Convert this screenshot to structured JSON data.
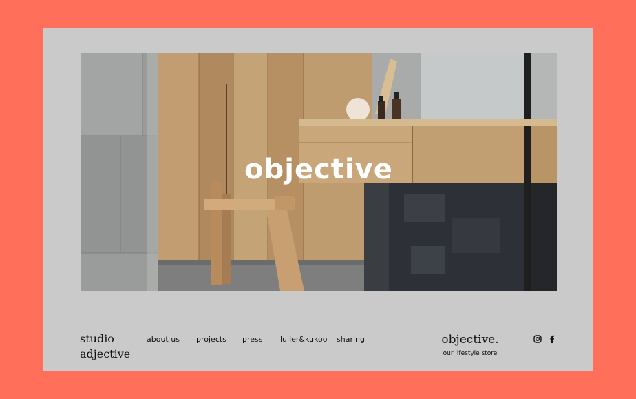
{
  "hero": {
    "logo_text": "objective",
    "logo_color": "#FFFFFF"
  },
  "brand": {
    "line1": "studio",
    "line2": "adjective"
  },
  "nav": {
    "items": [
      {
        "label": "about us"
      },
      {
        "label": "projects"
      },
      {
        "label": "press"
      },
      {
        "label": "luller&kukoo"
      },
      {
        "label": "sharing"
      }
    ]
  },
  "store": {
    "name": "objective.",
    "subtitle": "our lifestyle store"
  },
  "social": {
    "icons": [
      "instagram-icon",
      "facebook-icon"
    ]
  },
  "colors": {
    "background": "#FF6F59",
    "card": "#CACACA",
    "text": "#111111"
  }
}
